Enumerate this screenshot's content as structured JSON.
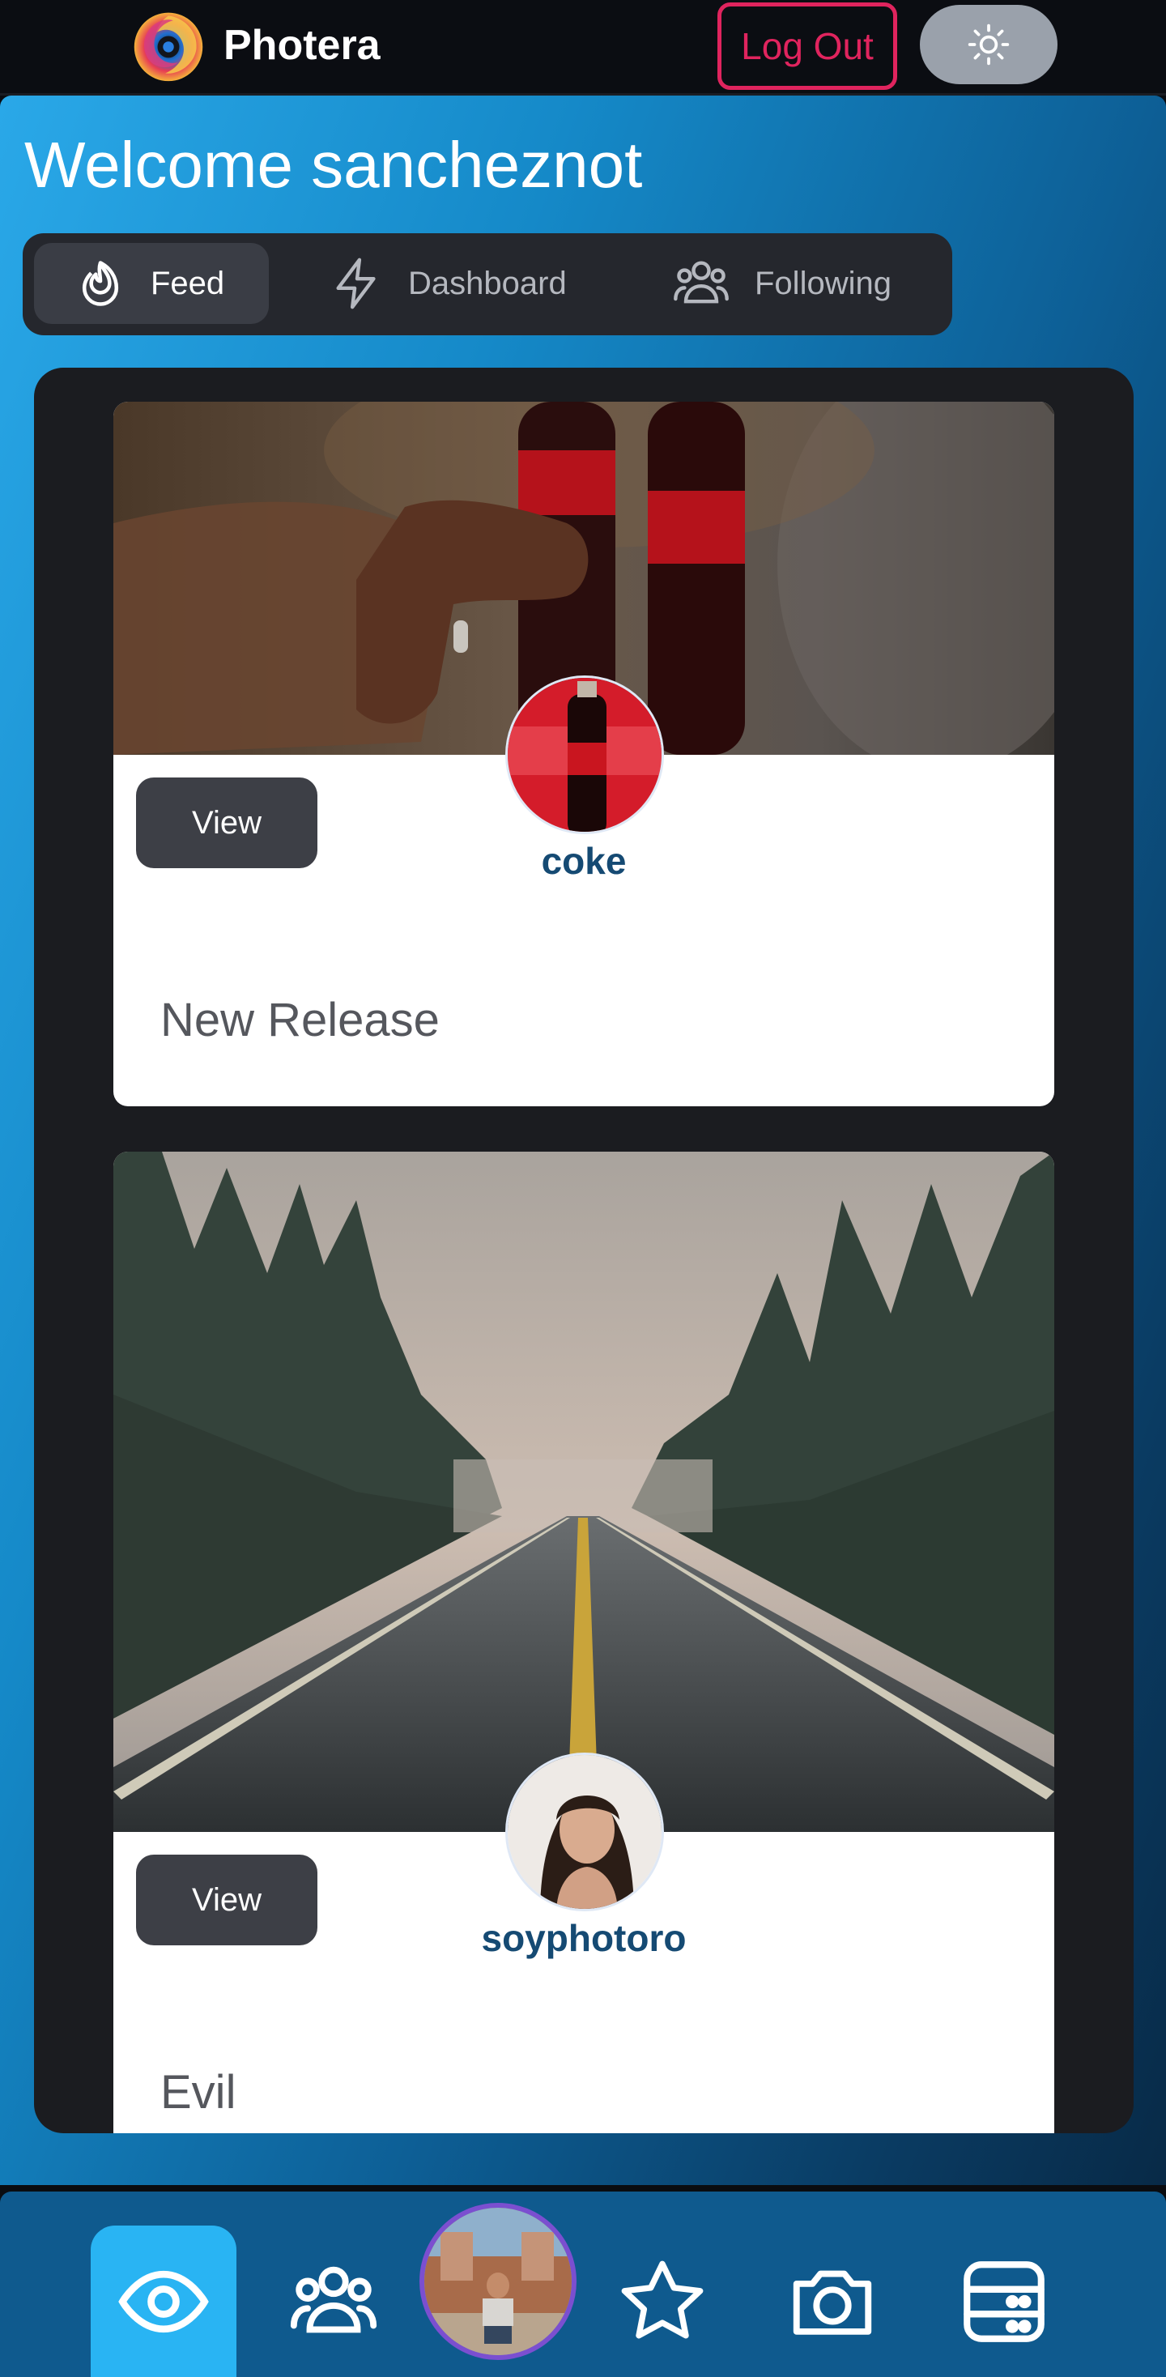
{
  "header": {
    "brand": "Photera",
    "logout_label": "Log Out",
    "theme_icon": "sun-icon"
  },
  "welcome": "Welcome sancheznot",
  "tabs": [
    {
      "label": "Feed",
      "icon": "flame-icon",
      "active": true
    },
    {
      "label": "Dashboard",
      "icon": "bolt-icon",
      "active": false
    },
    {
      "label": "Following",
      "icon": "users-icon",
      "active": false
    }
  ],
  "posts": [
    {
      "username": "coke",
      "view_label": "View",
      "caption": "New Release"
    },
    {
      "username": "soyphotoro",
      "view_label": "View",
      "caption": "Evil"
    }
  ],
  "bottom_nav": [
    {
      "icon": "eye-icon",
      "active": true
    },
    {
      "icon": "users-icon",
      "active": false
    },
    {
      "icon": "profile-avatar",
      "active": false
    },
    {
      "icon": "star-icon",
      "active": false
    },
    {
      "icon": "camera-icon",
      "active": false
    },
    {
      "icon": "server-icon",
      "active": false
    }
  ],
  "colors": {
    "accent": "#e0245e",
    "active_nav": "#29b4f3",
    "username": "#154a73"
  }
}
